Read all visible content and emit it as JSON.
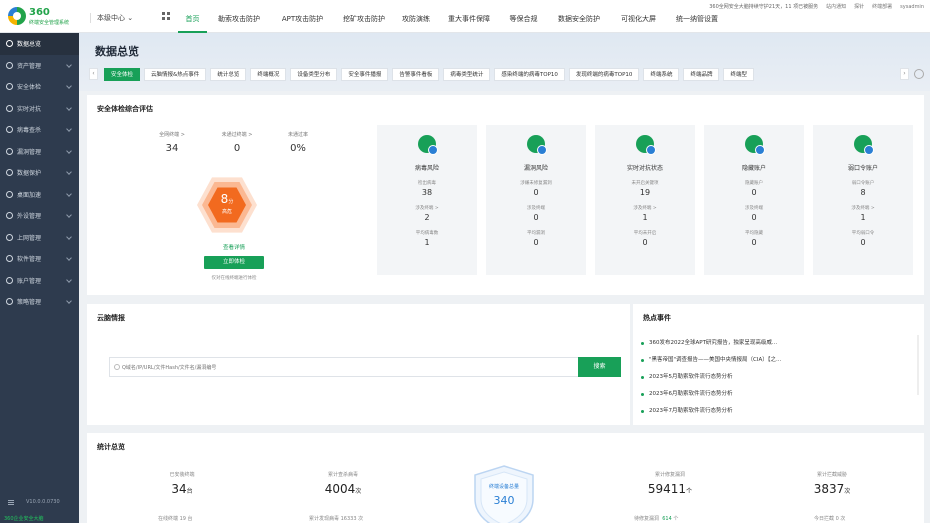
{
  "logo": {
    "brand": "360",
    "subtitle": "终端安全管理系统"
  },
  "center_switch": "本级中心",
  "nav": [
    "首页",
    "勒索攻击防护",
    "APT攻击防护",
    "挖矿攻击防护",
    "攻防演练",
    "重大事件保障",
    "等保合规",
    "数据安全防护",
    "可视化大屏",
    "统一纳管设置"
  ],
  "topright": {
    "notice": "360全网安全大脑持续守护21天，11 项已被服务",
    "items": [
      "站内通知",
      "探针",
      "终端部署",
      "sysadmin"
    ]
  },
  "sidebar": [
    {
      "label": "数据总览"
    },
    {
      "label": "资产管理"
    },
    {
      "label": "安全体检"
    },
    {
      "label": "实时对抗"
    },
    {
      "label": "病毒查杀"
    },
    {
      "label": "漏洞管理"
    },
    {
      "label": "数据保护"
    },
    {
      "label": "桌面加速"
    },
    {
      "label": "外设管理"
    },
    {
      "label": "上网管理"
    },
    {
      "label": "软件管理"
    },
    {
      "label": "账户管理"
    },
    {
      "label": "策略管理"
    }
  ],
  "version": "V10.0.0.0730",
  "sidebar_brand": "360企业安全大脑",
  "page_title": "数据总览",
  "tabs": [
    "安全体检",
    "云脑情报&热点事件",
    "统计总览",
    "终端概况",
    "设备类型分布",
    "安全事件播报",
    "告警事件看板",
    "病毒类型统计",
    "感染终端的病毒TOP10",
    "发现终端的病毒TOP10",
    "终端系统",
    "终端品牌",
    "终端型"
  ],
  "health": {
    "title": "安全体检综合评估",
    "stats": [
      {
        "label": "全网终端 >",
        "value": "34"
      },
      {
        "label": "未通过终端 >",
        "value": "0"
      },
      {
        "label": "未通过率",
        "value": "0%"
      }
    ],
    "score": "8",
    "score_unit": "分",
    "level": "高危",
    "detail_link": "查看详情",
    "button": "立即体检",
    "hint": "仅对在线终端进行体检",
    "risks": [
      {
        "title": "病毒风险",
        "l1": "检出病毒",
        "v1": "38",
        "l2": "涉及终端 >",
        "v2": "2",
        "l3": "平均病毒数",
        "v3": "1"
      },
      {
        "title": "漏洞风险",
        "l1": "涉嫌未修复漏洞",
        "v1": "0",
        "l2": "涉及终端",
        "v2": "0",
        "l3": "平均漏洞",
        "v3": "0"
      },
      {
        "title": "实时对抗状态",
        "l1": "未开启关键项",
        "v1": "19",
        "l2": "涉及终端 >",
        "v2": "1",
        "l3": "平均未开启",
        "v3": "0"
      },
      {
        "title": "隐藏账户",
        "l1": "隐藏账户",
        "v1": "0",
        "l2": "涉及终端",
        "v2": "0",
        "l3": "平均隐藏",
        "v3": "0"
      },
      {
        "title": "弱口令账户",
        "l1": "弱口令账户",
        "v1": "8",
        "l2": "涉及终端 >",
        "v2": "1",
        "l3": "平均弱口令",
        "v3": "0"
      }
    ]
  },
  "cloud": {
    "title": "云脑情报",
    "placeholder": "Q域名/IP/URL/文件Hash/文件名/漏洞编号",
    "search_button": "搜索"
  },
  "hot": {
    "title": "热点事件",
    "items": [
      "360发布2022全球APT研究报告，独家呈现高级威...",
      "\"黑客帝国\"调查报告——美国中央情报局（CIA）【之...",
      "2023年5月勒索软件流行态势分析",
      "2023年6月勒索软件流行态势分析",
      "2023年7月勒索软件流行态势分析"
    ]
  },
  "stats": {
    "title": "统计总览",
    "blocks": [
      {
        "label": "已安装终端",
        "value": "34",
        "unit": "台",
        "sub": "在线终端 19 台"
      },
      {
        "label": "累计查杀病毒",
        "value": "4004",
        "unit": "次",
        "sub": "累计发现病毒 16333 次"
      },
      {
        "label": "累计修复漏洞",
        "value": "59411",
        "unit": "个",
        "sub_pre": "待修复漏洞",
        "sub_hl": "614",
        "sub_post": "个"
      },
      {
        "label": "累计拦截威胁",
        "value": "3837",
        "unit": "次",
        "sub": "今日拦截 0 次"
      }
    ],
    "center_label": "终端设备总量",
    "center_value": "340"
  }
}
